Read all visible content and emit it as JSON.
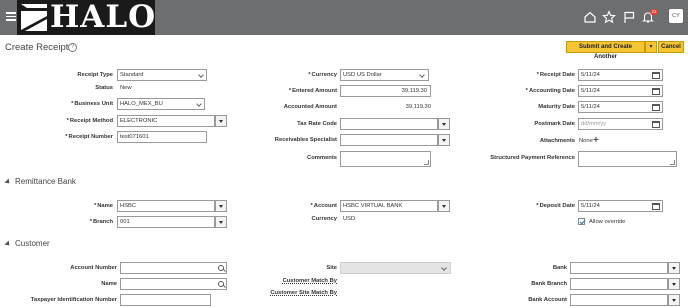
{
  "header": {
    "logo_text": "HALO",
    "notification_count": "23",
    "user_initials": "CY",
    "icons": [
      "menu-icon",
      "home-icon",
      "star-icon",
      "flag-icon",
      "bell-icon"
    ]
  },
  "page": {
    "title": "Create Receipt",
    "save_label": "Submit and Create Another",
    "cancel_label": "Cancel"
  },
  "receipt": {
    "receipt_type_label": "Receipt Type",
    "receipt_type": "Standard",
    "status_label": "Status",
    "status": "New",
    "business_unit_label": "Business Unit",
    "business_unit": "HALO_MEX_BU",
    "receipt_method_label": "Receipt Method",
    "receipt_method": "ELECTRONIC",
    "receipt_number_label": "Receipt Number",
    "receipt_number": "test071601",
    "currency_label": "Currency",
    "currency": "USD US Dollar",
    "entered_amount_label": "Entered Amount",
    "entered_amount": "39,119.30",
    "accounted_amount_label": "Accounted Amount",
    "accounted_amount": "39,119.30",
    "tax_rate_code_label": "Tax Rate Code",
    "tax_rate_code": "",
    "receivables_specialist_label": "Receivables Specialist",
    "receivables_specialist": "",
    "comments_label": "Comments",
    "receipt_date_label": "Receipt Date",
    "receipt_date": "5/11/24",
    "accounting_date_label": "Accounting Date",
    "accounting_date": "5/11/24",
    "maturity_date_label": "Maturity Date",
    "maturity_date": "5/11/24",
    "postmark_date_label": "Postmark Date",
    "postmark_date_placeholder": "dd/mm/yy",
    "attachments_label": "Attachments",
    "attachments_value": "None",
    "structured_payment_label": "Structured Payment Reference"
  },
  "remittance": {
    "section_title": "Remittance Bank",
    "name_label": "Name",
    "name": "HSBC",
    "branch_label": "Branch",
    "branch": "001",
    "account_label": "Account",
    "account": "HSBC VIRTUAL BANK",
    "currency_label": "Currency",
    "currency": "USD",
    "deposit_date_label": "Deposit Date",
    "deposit_date": "5/11/24",
    "allow_override_label": "Allow override",
    "allow_override_checked": true
  },
  "customer": {
    "section_title": "Customer",
    "account_number_label": "Account Number",
    "name_label": "Name",
    "taxpayer_label": "Taxpayer Identification Number",
    "site_label": "Site",
    "customer_match_by_label": "Customer Match By",
    "customer_site_match_by_label": "Customer Site Match By",
    "bank_label": "Bank",
    "bank_branch_label": "Bank Branch",
    "bank_account_label": "Bank Account"
  }
}
